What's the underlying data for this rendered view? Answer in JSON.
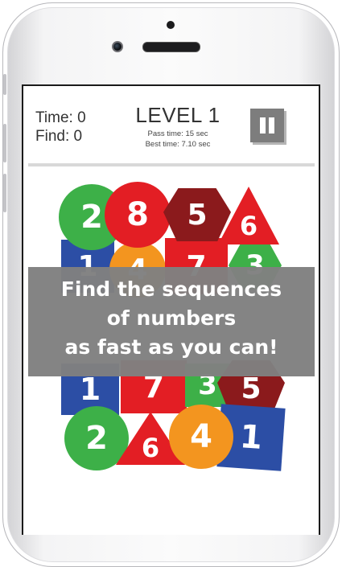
{
  "game": {
    "time_label": "Time: 0",
    "find_label": "Find: 0",
    "level_title": "LEVEL 1",
    "pass_time": "Pass time: 15 sec",
    "best_time": "Best time: 7.10 sec"
  },
  "tiles": {
    "top_circle_green": "2",
    "top_circle_red": "8",
    "top_hexagon": "5",
    "top_triangle": "6",
    "mid_square_blue": "1",
    "mid_circle_orange": "4",
    "mid_square_red": "7",
    "mid_hexagon_green": "3",
    "low_square_blue": "1",
    "low_square_red": "7",
    "low_square_green": "3",
    "low_hexagon_red": "5",
    "bottom_circle_green": "2",
    "bottom_triangle": "6",
    "bottom_circle_orange": "4",
    "bottom_square_blue": "1"
  },
  "overlay": {
    "line1": "Find the sequences",
    "line2": "of numbers",
    "line3": "as fast as you can!"
  },
  "colors": {
    "red": "#e31e24",
    "dark_red": "#8b1a1c",
    "green": "#3db048",
    "blue": "#2c4ea5",
    "orange": "#f3951f",
    "overlay_gray": "#808080"
  }
}
